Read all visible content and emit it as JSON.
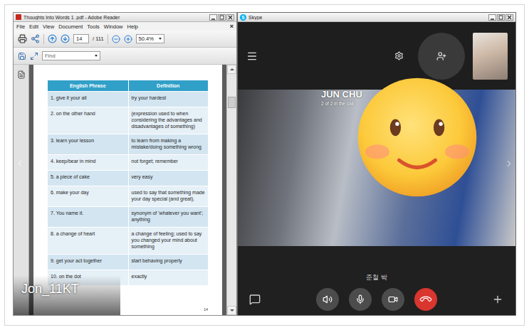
{
  "reader": {
    "title": "Thoughts Into Words 1 .pdf - Adobe Reader",
    "menu": [
      "File",
      "Edit",
      "View",
      "Document",
      "Tools",
      "Window",
      "Help"
    ],
    "menu_close": "×",
    "page_field": "14",
    "page_total": "/ 111",
    "zoom": "50.4%",
    "find": {
      "placeholder": "Find"
    },
    "table": {
      "columns": [
        "English Phrase",
        "Definition"
      ],
      "rows": [
        {
          "phrase": "1. give it your all",
          "definition": "try your hardest"
        },
        {
          "phrase": "2. on the other hand",
          "definition": "(expression used to when considering the advantages and disadvantages of something)"
        },
        {
          "phrase": "3. learn your lesson",
          "definition": "to learn from making a mistake/doing something wrong"
        },
        {
          "phrase": "4. keep/bear in mind",
          "definition": "not forget; remember"
        },
        {
          "phrase": "5. a piece of cake",
          "definition": "very easy"
        },
        {
          "phrase": "6. make your day",
          "definition": "used to say that something made your day special (and great)."
        },
        {
          "phrase": "7. You name it.",
          "definition": "synonym of 'whatever you want'; anything"
        },
        {
          "phrase": "8. a change of heart",
          "definition": "a change of feeling; used to say you changed your mind about something"
        },
        {
          "phrase": "9. get your act together",
          "definition": "start behaving properly"
        },
        {
          "phrase": "10. on the dot",
          "definition": "exactly"
        }
      ]
    },
    "page_number": "14"
  },
  "caption": "Jon_11KT",
  "skype": {
    "logo": "S",
    "title": "Skype",
    "caller_name": "JUN CHU",
    "call_status": "2 of 2 in the call",
    "display_name": "준철 박"
  }
}
